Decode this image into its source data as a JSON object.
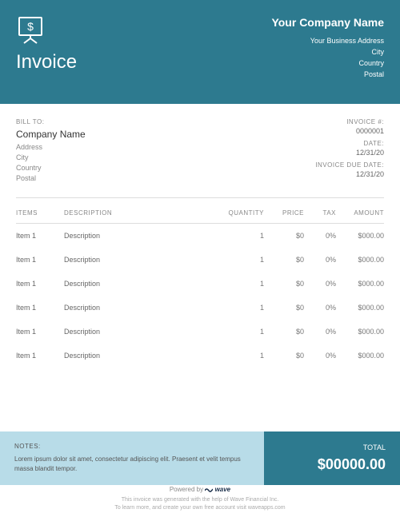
{
  "header": {
    "title": "Invoice",
    "company_name": "Your Company Name",
    "address": "Your Business Address",
    "city": "City",
    "country": "Country",
    "postal": "Postal"
  },
  "bill_to": {
    "label": "BILL TO:",
    "company": "Company Name",
    "address": "Address",
    "city": "City",
    "country": "Country",
    "postal": "Postal"
  },
  "invoice_meta": {
    "number_label": "INVOICE #:",
    "number": "0000001",
    "date_label": "DATE:",
    "date": "12/31/20",
    "due_label": "INVOICE DUE DATE:",
    "due": "12/31/20"
  },
  "table": {
    "headers": {
      "items": "ITEMS",
      "description": "DESCRIPTION",
      "quantity": "QUANTITY",
      "price": "PRICE",
      "tax": "TAX",
      "amount": "AMOUNT"
    },
    "rows": [
      {
        "item": "Item 1",
        "description": "Description",
        "quantity": "1",
        "price": "$0",
        "tax": "0%",
        "amount": "$000.00"
      },
      {
        "item": "Item 1",
        "description": "Description",
        "quantity": "1",
        "price": "$0",
        "tax": "0%",
        "amount": "$000.00"
      },
      {
        "item": "Item 1",
        "description": "Description",
        "quantity": "1",
        "price": "$0",
        "tax": "0%",
        "amount": "$000.00"
      },
      {
        "item": "Item 1",
        "description": "Description",
        "quantity": "1",
        "price": "$0",
        "tax": "0%",
        "amount": "$000.00"
      },
      {
        "item": "Item 1",
        "description": "Description",
        "quantity": "1",
        "price": "$0",
        "tax": "0%",
        "amount": "$000.00"
      },
      {
        "item": "Item 1",
        "description": "Description",
        "quantity": "1",
        "price": "$0",
        "tax": "0%",
        "amount": "$000.00"
      }
    ]
  },
  "notes": {
    "label": "NOTES:",
    "text": "Lorem ipsum dolor sit amet, consectetur adipiscing elit. Praesent et velit tempus massa blandit tempor."
  },
  "total": {
    "label": "TOTAL",
    "value": "$00000.00"
  },
  "powered": {
    "prefix": "Powered by",
    "brand": "wave",
    "line1": "This invoice was generated with the help of Wave Financial Inc.",
    "line2": "To learn more, and create your own free account visit waveapps.com"
  }
}
